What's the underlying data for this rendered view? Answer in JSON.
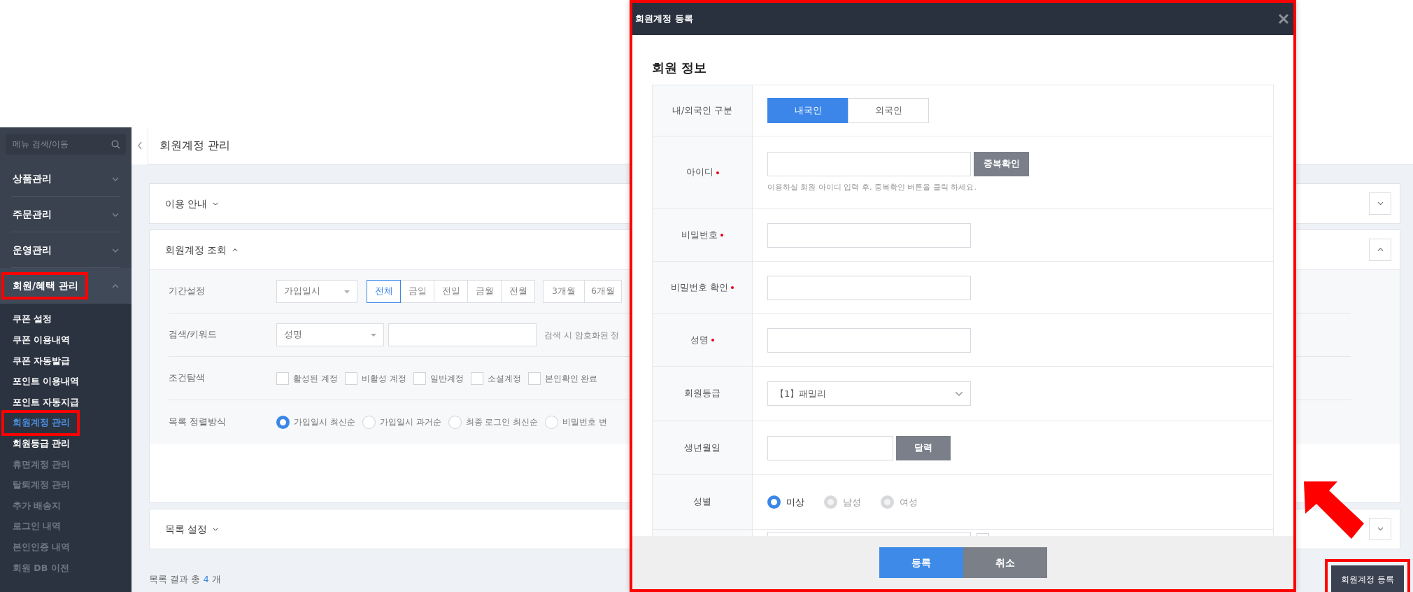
{
  "sidebar": {
    "search_placeholder": "메뉴 검색/이동",
    "menus": [
      {
        "label": "상품관리",
        "expanded": false,
        "highlight": false
      },
      {
        "label": "주문관리",
        "expanded": false,
        "highlight": false
      },
      {
        "label": "운영관리",
        "expanded": false,
        "highlight": false
      },
      {
        "label": "회원/혜택 관리",
        "expanded": true,
        "highlight": true,
        "children": [
          {
            "label": "쿠폰 설정",
            "selected": false,
            "disabled": false,
            "highlight": false
          },
          {
            "label": "쿠폰 이용내역",
            "selected": false,
            "disabled": false,
            "highlight": false
          },
          {
            "label": "쿠폰 자동발급",
            "selected": false,
            "disabled": false,
            "highlight": false
          },
          {
            "label": "포인트 이용내역",
            "selected": false,
            "disabled": false,
            "highlight": false
          },
          {
            "label": "포인트 자동지급",
            "selected": false,
            "disabled": false,
            "highlight": false
          },
          {
            "label": "회원계정 관리",
            "selected": true,
            "disabled": false,
            "highlight": true
          },
          {
            "label": "회원등급 관리",
            "selected": false,
            "disabled": false,
            "highlight": false
          },
          {
            "label": "휴면계정 관리",
            "selected": false,
            "disabled": true,
            "highlight": false
          },
          {
            "label": "탈퇴계정 관리",
            "selected": false,
            "disabled": true,
            "highlight": false
          },
          {
            "label": "추가 배송지",
            "selected": false,
            "disabled": true,
            "highlight": false
          },
          {
            "label": "로그인 내역",
            "selected": false,
            "disabled": true,
            "highlight": false
          },
          {
            "label": "본인인증 내역",
            "selected": false,
            "disabled": true,
            "highlight": false
          },
          {
            "label": "회원 DB 이전",
            "selected": false,
            "disabled": true,
            "highlight": false
          }
        ]
      }
    ]
  },
  "header": {
    "title": "회원계정 관리"
  },
  "panels": [
    {
      "title": "이용 안내",
      "expanded": false
    },
    {
      "title": "회원계정 조회",
      "expanded": true,
      "filters": [
        {
          "kind": "date",
          "label": "기간설정",
          "select": "가입일시",
          "groups": [
            [
              {
                "label": "전체",
                "selected": true
              },
              {
                "label": "금일",
                "selected": false
              },
              {
                "label": "전일",
                "selected": false
              },
              {
                "label": "금월",
                "selected": false
              },
              {
                "label": "전월",
                "selected": false
              }
            ],
            [
              {
                "label": "3개월",
                "selected": false
              },
              {
                "label": "6개월",
                "selected": false
              }
            ]
          ]
        },
        {
          "kind": "keyword",
          "label": "검색/키워드",
          "select": "성명",
          "hint": "검색 시 암호화된 정"
        },
        {
          "kind": "checks",
          "label": "조건탐색",
          "options": [
            {
              "label": "활성된 계정",
              "checked": false
            },
            {
              "label": "비활성 계정",
              "checked": false
            },
            {
              "label": "일반계정",
              "checked": false
            },
            {
              "label": "소셜계정",
              "checked": false
            },
            {
              "label": "본인확인 완료",
              "checked": false
            }
          ]
        },
        {
          "kind": "radios",
          "label": "목록 정렬방식",
          "options": [
            {
              "label": "가입일시 최신순",
              "selected": true
            },
            {
              "label": "가입일시 과거순",
              "selected": false
            },
            {
              "label": "최종 로그인 최신순",
              "selected": false
            },
            {
              "label": "비밀번호 변",
              "selected": false
            }
          ]
        }
      ]
    },
    {
      "title": "목록 설정",
      "expanded": false
    }
  ],
  "result_summary": {
    "prefix": "목록 결과 총",
    "count": "4",
    "suffix": "개"
  },
  "register_button": {
    "label": "회원계정 등록",
    "highlight": true
  },
  "modal": {
    "title": "회원계정 등록",
    "highlight": true,
    "section_title": "회원 정보",
    "rows": [
      {
        "kind": "segmented",
        "label": "내/외국인 구분",
        "required": false,
        "options": [
          {
            "label": "내국인",
            "selected": true
          },
          {
            "label": "외국인",
            "selected": false
          }
        ]
      },
      {
        "kind": "id",
        "label": "아이디",
        "required": true,
        "button": "중복확인",
        "help": "이용하실 회원 아이디 입력 후, 중복확인 버튼을 클릭 하세요."
      },
      {
        "kind": "text",
        "label": "비밀번호",
        "required": true
      },
      {
        "kind": "text",
        "label": "비밀번호 확인",
        "required": true
      },
      {
        "kind": "text",
        "label": "성명",
        "required": true
      },
      {
        "kind": "select",
        "label": "회원등급",
        "required": false,
        "value": "【1】패밀리"
      },
      {
        "kind": "date",
        "label": "생년월일",
        "required": false,
        "button": "달력"
      },
      {
        "kind": "radios",
        "label": "성별",
        "required": false,
        "options": [
          {
            "label": "미상",
            "selected": true
          },
          {
            "label": "남성",
            "selected": false
          },
          {
            "label": "여성",
            "selected": false
          }
        ]
      },
      {
        "kind": "cut",
        "checked": false
      }
    ],
    "buttons": [
      {
        "label": "등록",
        "kind": "primary"
      },
      {
        "label": "취소",
        "kind": "secondary"
      }
    ]
  }
}
